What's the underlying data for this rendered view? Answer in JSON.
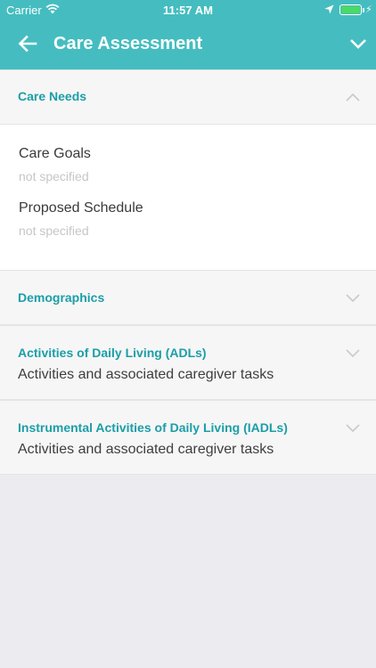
{
  "status_bar": {
    "carrier": "Carrier",
    "time": "11:57 AM",
    "battery_level": 1.0
  },
  "nav": {
    "title": "Care Assessment"
  },
  "care_needs": {
    "title": "Care Needs",
    "fields": [
      {
        "label": "Care Goals",
        "value": "not specified"
      },
      {
        "label": "Proposed Schedule",
        "value": "not specified"
      }
    ]
  },
  "sections": [
    {
      "title": "Demographics",
      "subtitle": ""
    },
    {
      "title": "Activities of Daily Living (ADLs)",
      "subtitle": "Activities and associated caregiver tasks"
    },
    {
      "title": "Instrumental Activities of Daily Living (IADLs)",
      "subtitle": "Activities and associated caregiver tasks"
    }
  ],
  "colors": {
    "accent": "#45bdc0",
    "section_title": "#1b9ea8",
    "background": "#ebebf0"
  }
}
